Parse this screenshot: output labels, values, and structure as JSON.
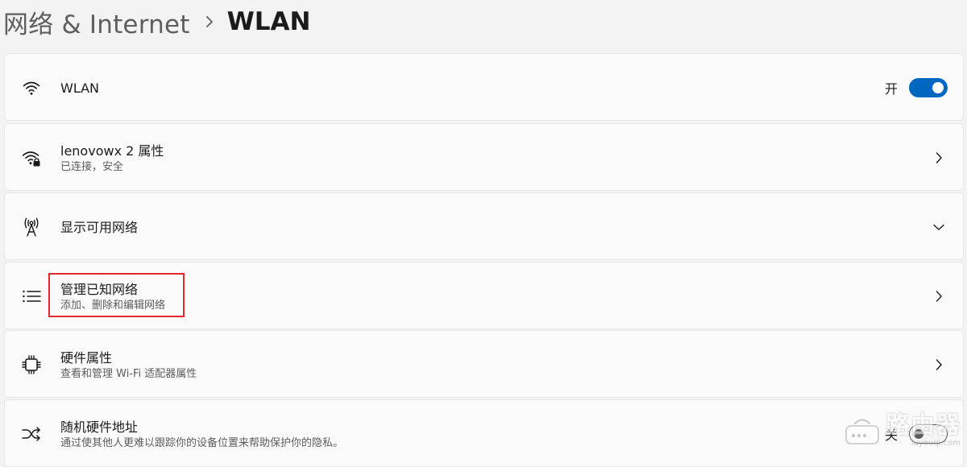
{
  "header": {
    "parent": "网络 & Internet",
    "current": "WLAN"
  },
  "colors": {
    "accent": "#0067c0",
    "highlight": "#e0282e"
  },
  "rows": {
    "wlan": {
      "icon": "wifi-icon",
      "title": "WLAN",
      "toggle_label": "开",
      "toggle_on": true
    },
    "properties": {
      "icon": "wifi-lock-icon",
      "title": "lenovowx 2 属性",
      "subtitle": "已连接，安全"
    },
    "available": {
      "icon": "antenna-icon",
      "title": "显示可用网络"
    },
    "known": {
      "icon": "list-icon",
      "title": "管理已知网络",
      "subtitle": "添加、删除和编辑网络"
    },
    "hardware": {
      "icon": "chip-icon",
      "title": "硬件属性",
      "subtitle": "查看和管理 Wi-Fi 适配器属性"
    },
    "random_mac": {
      "icon": "shuffle-icon",
      "title": "随机硬件地址",
      "subtitle": "通过使其他人更难以跟踪你的设备位置来帮助保护你的隐私。",
      "toggle_label": "关",
      "toggle_on": false
    }
  },
  "watermark": {
    "main": "路由器",
    "sub": "luyouqi.com"
  }
}
